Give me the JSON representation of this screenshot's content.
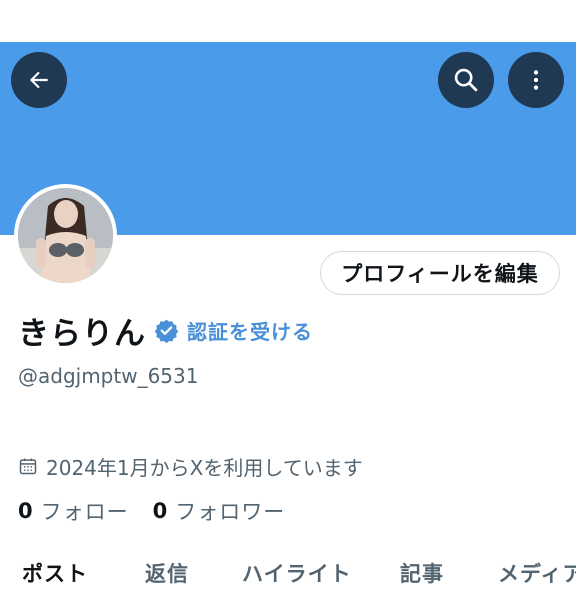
{
  "profile": {
    "display_name": "きらりん",
    "verify_link": "認証を受ける",
    "handle": "@adgjmptw_6531",
    "joined": "2024年1月からXを利用しています",
    "edit_button": "プロフィールを編集"
  },
  "stats": {
    "following_count": "0",
    "following_label": "フォロー",
    "followers_count": "0",
    "followers_label": "フォロワー"
  },
  "tabs": [
    {
      "label": "ポスト",
      "active": true
    },
    {
      "label": "返信",
      "active": false
    },
    {
      "label": "ハイライト",
      "active": false
    },
    {
      "label": "記事",
      "active": false
    },
    {
      "label": "メディア",
      "active": false
    }
  ],
  "icons": {
    "back": "arrow-left-icon",
    "search": "search-icon",
    "more": "more-vertical-icon",
    "verified": "verified-badge-icon",
    "calendar": "calendar-icon"
  },
  "colors": {
    "banner": "#4a9bea",
    "verify_blue": "#4a90d9",
    "text_primary": "#0f1419",
    "text_secondary": "#536471"
  }
}
